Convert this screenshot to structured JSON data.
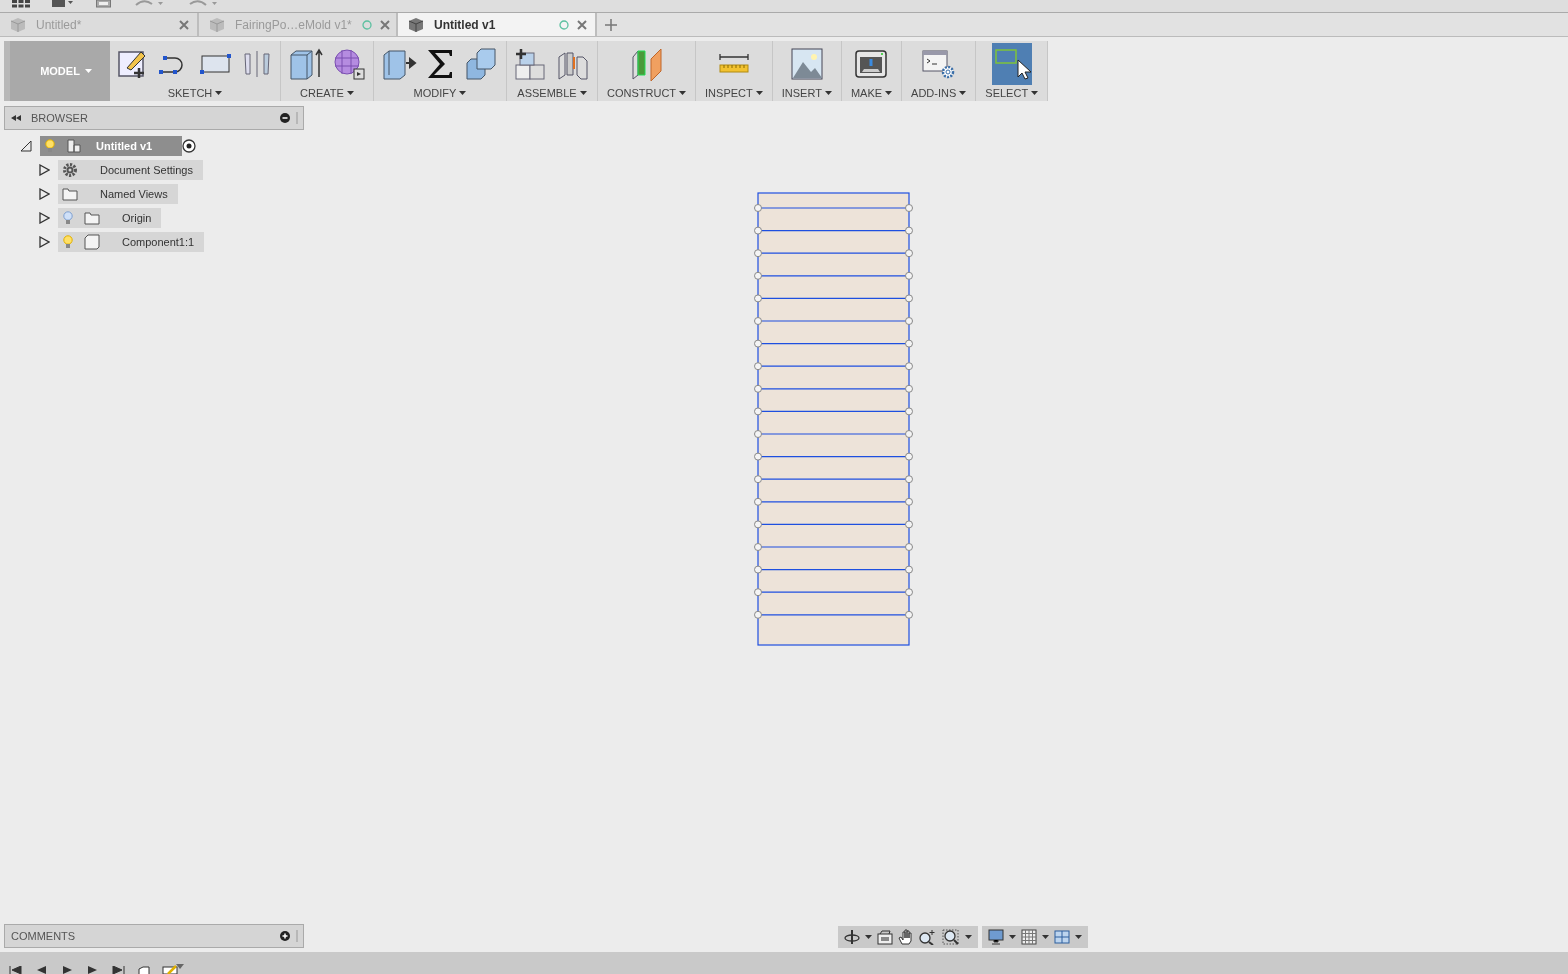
{
  "document_tabs": [
    {
      "title": "Untitled*",
      "selected": false,
      "status_circle": false
    },
    {
      "title": "FairingPo…eMold v1*",
      "selected": false,
      "status_circle": true
    },
    {
      "title": "Untitled v1",
      "selected": true,
      "status_circle": true
    }
  ],
  "toolbar": {
    "workspace": "MODEL",
    "groups": [
      {
        "label": "SKETCH",
        "kind": "sketch",
        "selected": false
      },
      {
        "label": "CREATE",
        "kind": "create",
        "selected": false
      },
      {
        "label": "MODIFY",
        "kind": "modify",
        "selected": false
      },
      {
        "label": "ASSEMBLE",
        "kind": "assemble",
        "selected": false
      },
      {
        "label": "CONSTRUCT",
        "kind": "construct",
        "selected": false
      },
      {
        "label": "INSPECT",
        "kind": "inspect",
        "selected": false
      },
      {
        "label": "INSERT",
        "kind": "insert",
        "selected": false
      },
      {
        "label": "MAKE",
        "kind": "make",
        "selected": false
      },
      {
        "label": "ADD-INS",
        "kind": "addins",
        "selected": false
      },
      {
        "label": "SELECT",
        "kind": "select",
        "selected": true
      }
    ]
  },
  "browser": {
    "title": "BROWSER",
    "tree": [
      {
        "label": "Untitled v1",
        "kind": "component",
        "light_on": true,
        "expanded": true,
        "selected": true,
        "children": [
          {
            "label": "Document Settings",
            "kind": "settings",
            "expanded": false,
            "selected": false
          },
          {
            "label": "Named Views",
            "kind": "folder",
            "expanded": false,
            "selected": false
          },
          {
            "label": "Origin",
            "kind": "folder",
            "light_on": false,
            "expanded": false,
            "selected": false
          },
          {
            "label": "Component1:1",
            "kind": "body",
            "light_on": true,
            "expanded": false,
            "selected": false
          }
        ]
      }
    ]
  },
  "comments": {
    "title": "COMMENTS"
  }
}
